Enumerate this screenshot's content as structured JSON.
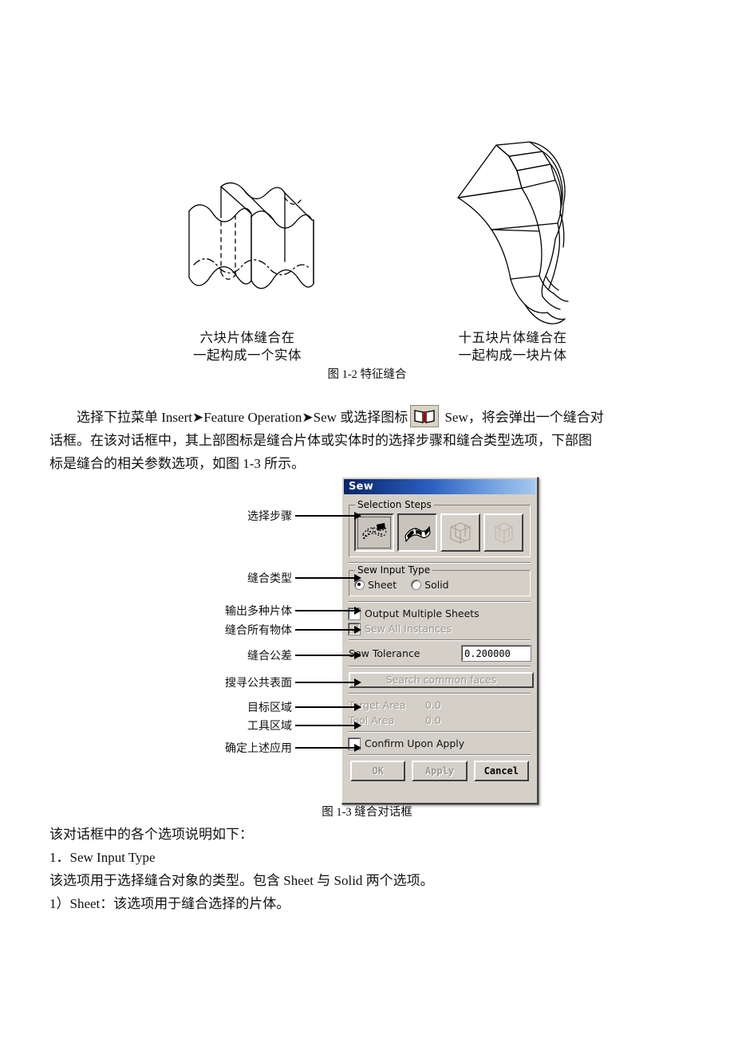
{
  "figure_1_2": {
    "caption": "图 1-2   特征缝合",
    "left_drawing_name": "six-patch-solid-drawing",
    "right_drawing_name": "fifteen-patch-sheet-drawing",
    "left_caption_line1": "六块片体缝合在",
    "left_caption_line2": "一起构成一个实体",
    "right_caption_line1": "十五块片体缝合在",
    "right_caption_line2": "一起构成一块片体"
  },
  "paragraph1": {
    "line1_a": "选择下拉菜单 Insert",
    "line1_arrow1": "➤",
    "line1_b": "Feature Operation",
    "line1_arrow2": "➤",
    "line1_c": "Sew 或选择图标",
    "icon_name": "open-book-icon",
    "line1_d": "Sew，将会弹出一个缝合对",
    "line2": "话框。在该对话框中，其上部图标是缝合片体或实体时的选择步骤和缝合类型选项，下部图",
    "line3": "标是缝合的相关参数选项，如图 1-3 所示。"
  },
  "dialog": {
    "title": "Sew",
    "selection_steps": {
      "group_label": "Selection Steps",
      "buttons": [
        {
          "name": "step-select-sheet-dotted",
          "state": "selected-focus"
        },
        {
          "name": "step-select-sheet-checkered",
          "state": "pressed"
        },
        {
          "name": "step-select-solid-target",
          "state": "disabled"
        },
        {
          "name": "step-select-solid-tool",
          "state": "disabled"
        }
      ]
    },
    "sew_input_type": {
      "group_label": "Sew Input Type",
      "options": [
        {
          "label": "Sheet",
          "selected": true
        },
        {
          "label": "Solid",
          "selected": false
        }
      ]
    },
    "output_multiple_sheets": {
      "label": "Output Multiple Sheets",
      "checked": false,
      "enabled": true
    },
    "sew_all_instances": {
      "label": "Sew All Instances",
      "checked": true,
      "enabled": false
    },
    "sew_tolerance": {
      "label": "Sew Tolerance",
      "value": "0.200000"
    },
    "search_common_faces": {
      "label": "Search common faces",
      "enabled": false
    },
    "target_area": {
      "label": "Target Area",
      "value": "0.0",
      "enabled": false
    },
    "tool_area": {
      "label": "Tool Area",
      "value": "0.0",
      "enabled": false
    },
    "confirm_upon_apply": {
      "label": "Confirm Upon Apply",
      "checked": false,
      "enabled": true
    },
    "buttons": [
      {
        "label": "OK",
        "enabled": false
      },
      {
        "label": "Apply",
        "enabled": false
      },
      {
        "label": "Cancel",
        "enabled": true
      }
    ]
  },
  "annotations": [
    {
      "label": "选择步骤"
    },
    {
      "label": "缝合类型"
    },
    {
      "label": "输出多种片体"
    },
    {
      "label": "缝合所有物体"
    },
    {
      "label": "缝合公差"
    },
    {
      "label": "搜寻公共表面"
    },
    {
      "label": "目标区域"
    },
    {
      "label": "工具区域"
    },
    {
      "label": "确定上述应用"
    }
  ],
  "figure_1_3": {
    "caption": "图 1-3   缝合对话框"
  },
  "body_text": {
    "line1": "该对话框中的各个选项说明如下：",
    "line2": "1．Sew Input Type",
    "line3": "该选项用于选择缝合对象的类型。包含 Sheet 与 Solid 两个选项。",
    "line4": "1）Sheet：该选项用于缝合选择的片体。"
  },
  "colors": {
    "dialog_face": "#d4d0c8",
    "title_left": "#0a246a",
    "title_right": "#a6c8ef",
    "disabled_text": "#9a9a94"
  }
}
